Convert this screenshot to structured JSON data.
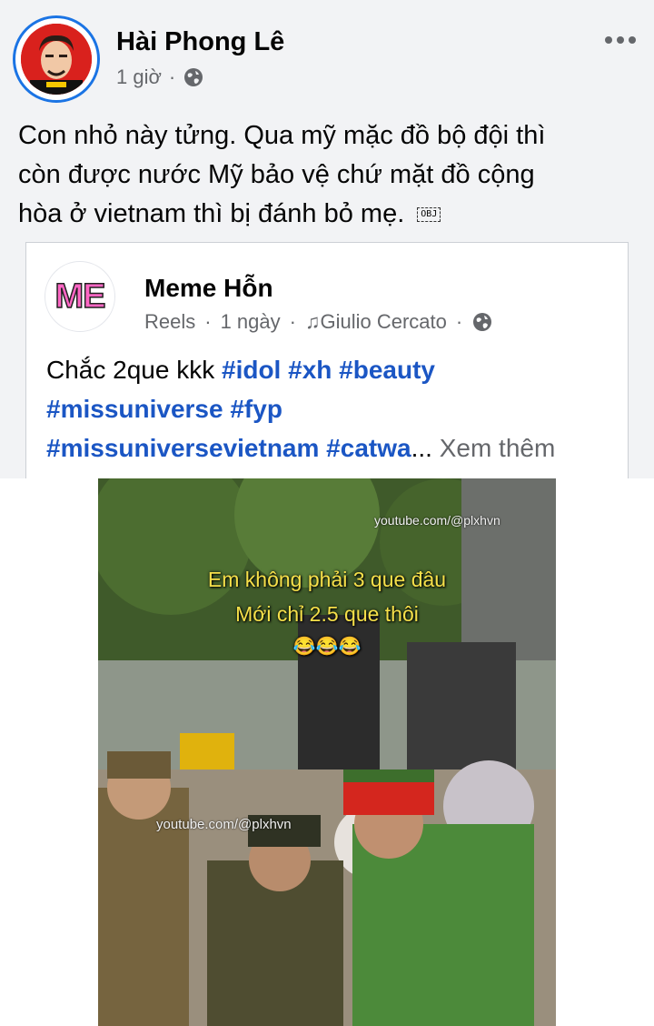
{
  "post": {
    "author": "Hài Phong Lê",
    "time": "1 giờ",
    "separator": "·",
    "privacy_icon": "globe-icon",
    "text_lines": [
      "Con nhỏ này tửng.  Qua mỹ mặc đồ bộ đội thì",
      "còn được nước Mỹ bảo vệ chứ mặt đồ cộng",
      "hòa ở vietnam thì bị đánh bỏ mẹ."
    ],
    "obj_marker": "OBJ"
  },
  "shared": {
    "avatar_text": "ME",
    "name": "Meme Hỗn",
    "type": "Reels",
    "time": "1 ngày",
    "music": "Giulio Cercato",
    "separator": "·",
    "text_plain": "Chắc 2que kkk ",
    "hashtags": [
      "#idol",
      "#xh",
      "#beauty",
      "#missuniverse",
      "#fyp",
      "#missuniversevietnam",
      "#catwa"
    ],
    "ellipsis": "...",
    "see_more": "Xem thêm"
  },
  "video": {
    "caption_line1": "Em không phải 3 que đâu",
    "caption_line2": "Mới chỉ 2.5 que thôi",
    "emojis": "😂😂😂",
    "watermark": "youtube.com/@plxhvn"
  },
  "colors": {
    "hashtag": "#1b56c4",
    "secondary_text": "#65676b",
    "caption": "#f6e04a",
    "avatar_ring": "#1b74e4"
  }
}
